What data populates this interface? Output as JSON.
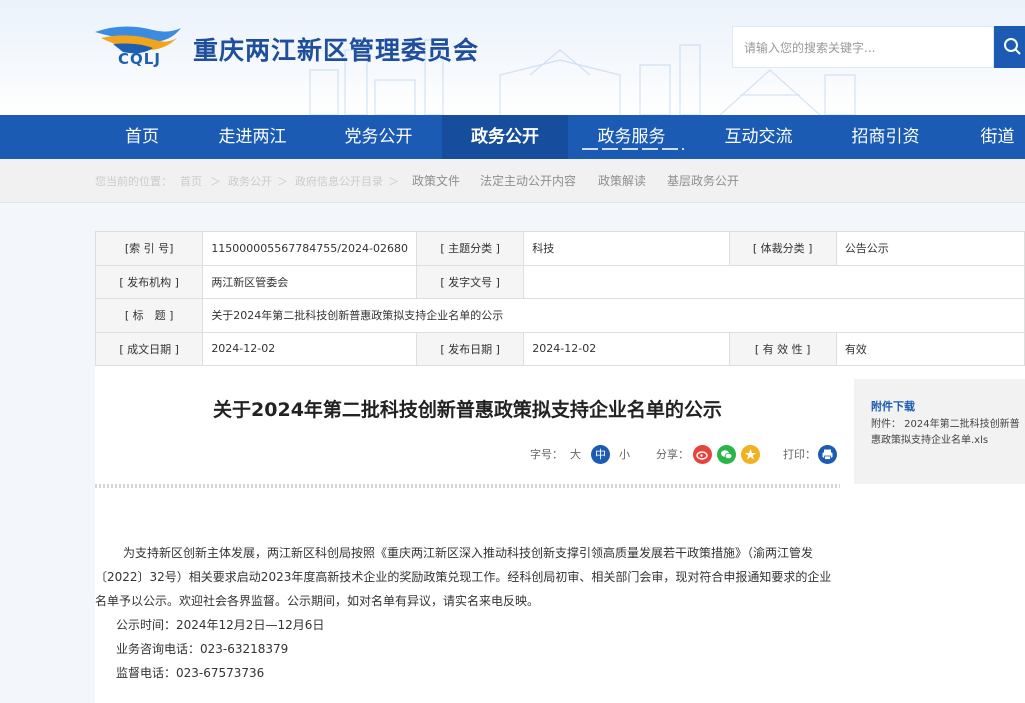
{
  "header": {
    "logo_text": "CQLJ",
    "site_title": "重庆两江新区管理委员会",
    "search_placeholder": "请输入您的搜索关键字..."
  },
  "nav": {
    "items": [
      "首页",
      "走进两江",
      "党务公开",
      "政务公开",
      "政务服务",
      "互动交流",
      "招商引资",
      "街道"
    ],
    "active": "政务公开"
  },
  "breadcrumb": {
    "location_label": "您当前的位置：",
    "items": [
      "首页",
      "政务公开",
      "政府信息公开目录"
    ],
    "separator": "＞",
    "subnav": [
      "政策文件",
      "法定主动公开内容",
      "政策解读",
      "基层政务公开"
    ]
  },
  "meta": {
    "index_label": "[索 引 号]",
    "index_value": "115000005567784755/2024-02680",
    "topic_label": "[ 主题分类 ]",
    "topic_value": "科技",
    "genre_label": "[ 体裁分类 ]",
    "genre_value": "公告公示",
    "org_label": "[ 发布机构 ]",
    "org_value": "两江新区管委会",
    "docno_label": "[ 发字文号 ]",
    "docno_value": "",
    "title_label": "[ 标　题 ]",
    "title_value": "关于2024年第二批科技创新普惠政策拟支持企业名单的公示",
    "date_label": "[ 成文日期 ]",
    "date_value": "2024-12-02",
    "pub_label": "[ 发布日期 ]",
    "pub_value": "2024-12-02",
    "valid_label": "[ 有 效 性 ]",
    "valid_value": "有效"
  },
  "article": {
    "title": "关于2024年第二批科技创新普惠政策拟支持企业名单的公示",
    "font_label": "字号：",
    "font_large": "大",
    "font_medium": "中",
    "font_small": "小",
    "share_label": "分享：",
    "print_label": "打印：",
    "paragraph": "为支持新区创新主体发展，两江新区科创局按照《重庆两江新区深入推动科技创新支撑引领高质量发展若干政策措施》（渝两江管发〔2022〕32号）相关要求启动2023年度高新技术企业的奖励政策兑现工作。经科创局初审、相关部门会审，现对符合申报通知要求的企业名单予以公示。欢迎社会各界监督。公示期间，如对名单有异议，请实名来电反映。",
    "period": "公示时间：2024年12月2日—12月6日",
    "consult_phone": "业务咨询电话：023-63218379",
    "supervise_phone": "监督电话：023-67573736"
  },
  "attachment": {
    "title": "附件下载",
    "link": "附件： 2024年第二批科技创新普惠政策拟支持企业名单.xls"
  },
  "colors": {
    "brand_blue": "#1b5bb3",
    "nav_active": "#164d9c",
    "font_active": "#1b5bb3",
    "weibo_red": "#e8433a",
    "wechat_green": "#2ab548",
    "favorite_orange": "#f2b11f"
  }
}
